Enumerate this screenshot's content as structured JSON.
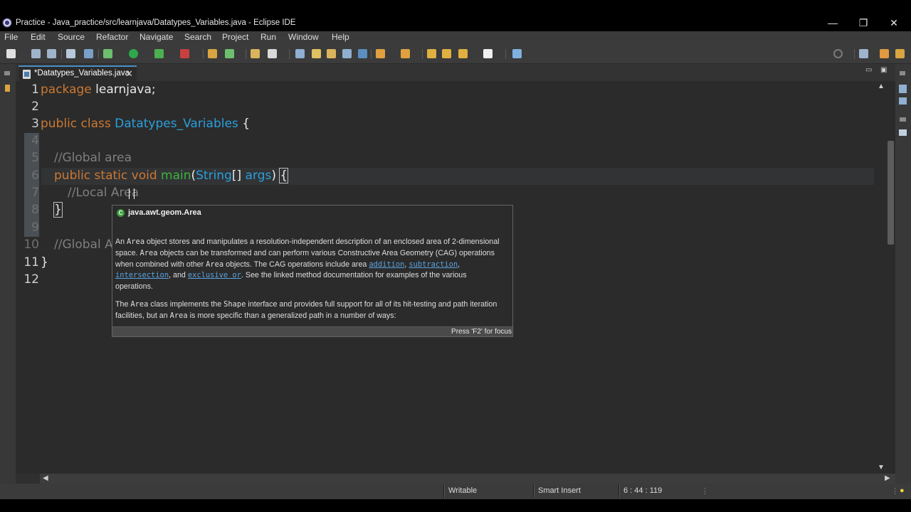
{
  "window": {
    "title": "Practice - Java_practice/src/learnjava/Datatypes_Variables.java - Eclipse IDE",
    "minimize": "—",
    "restore": "❐",
    "close": "✕"
  },
  "menu": [
    "File",
    "Edit",
    "Source",
    "Refactor",
    "Navigate",
    "Search",
    "Project",
    "Run",
    "Window",
    "Help"
  ],
  "tab": {
    "label": "*Datatypes_Variables.java",
    "close": "✕",
    "minimize": "▭",
    "maximize": "▣"
  },
  "code": {
    "line_numbers": [
      "1",
      "2",
      "3",
      "4",
      "5",
      "6",
      "7",
      "8",
      "9",
      "10",
      "11",
      "12"
    ],
    "l1": {
      "kw": "package",
      "rest": " learnjava;"
    },
    "l3": {
      "kw": "public class",
      "cls": "Datatypes_Variables",
      "rest": " {"
    },
    "l5": {
      "cmt": "//Global area"
    },
    "l6": {
      "kw": "public static void",
      "mth": "main",
      "p1": "(",
      "cls": "String",
      "p2": "[] ",
      "arg": "args",
      "p3": ") ",
      "brace": "{"
    },
    "l7": {
      "cmt": "//Local Area"
    },
    "l8": {
      "brace": "}"
    },
    "l10": {
      "cmt": "//Global A"
    },
    "l11": {
      "brace": "}"
    }
  },
  "tooltip": {
    "title": "java.awt.geom.Area",
    "p1": {
      "t1": "An ",
      "m1": "Area",
      "t2": " object stores and manipulates a resolution-independent description of an enclosed area of 2-dimensional space. ",
      "m2": "Area",
      "t3": " objects can be transformed and can perform various Constructive Area Geometry (CAG) operations when combined with other ",
      "m3": "Area",
      "t4": " objects. The CAG operations include area ",
      "l1": "addition",
      "t5": ", ",
      "l2": "subtraction",
      "t6": ", ",
      "l3": "intersection",
      "t7": ", and ",
      "l4": "exclusive or",
      "t8": ". See the linked method documentation for examples of the various operations."
    },
    "p2": {
      "t1": "The ",
      "m1": "Area",
      "t2": " class implements the ",
      "m2": "Shape",
      "t3": " interface and provides full support for all of its hit-testing and path iteration facilities, but an ",
      "m3": "Area",
      "t4": " is more specific than a generalized path in a number of ways:"
    },
    "footer": "Press 'F2' for focus"
  },
  "status": {
    "writable": "Writable",
    "insert_mode": "Smart Insert",
    "position": "6 : 44 : 119"
  },
  "colors": {
    "keyword": "#cc7832",
    "class": "#2b9fdc",
    "method": "#3db53d",
    "comment": "#7f7f7f",
    "link": "#5aa3e0"
  }
}
